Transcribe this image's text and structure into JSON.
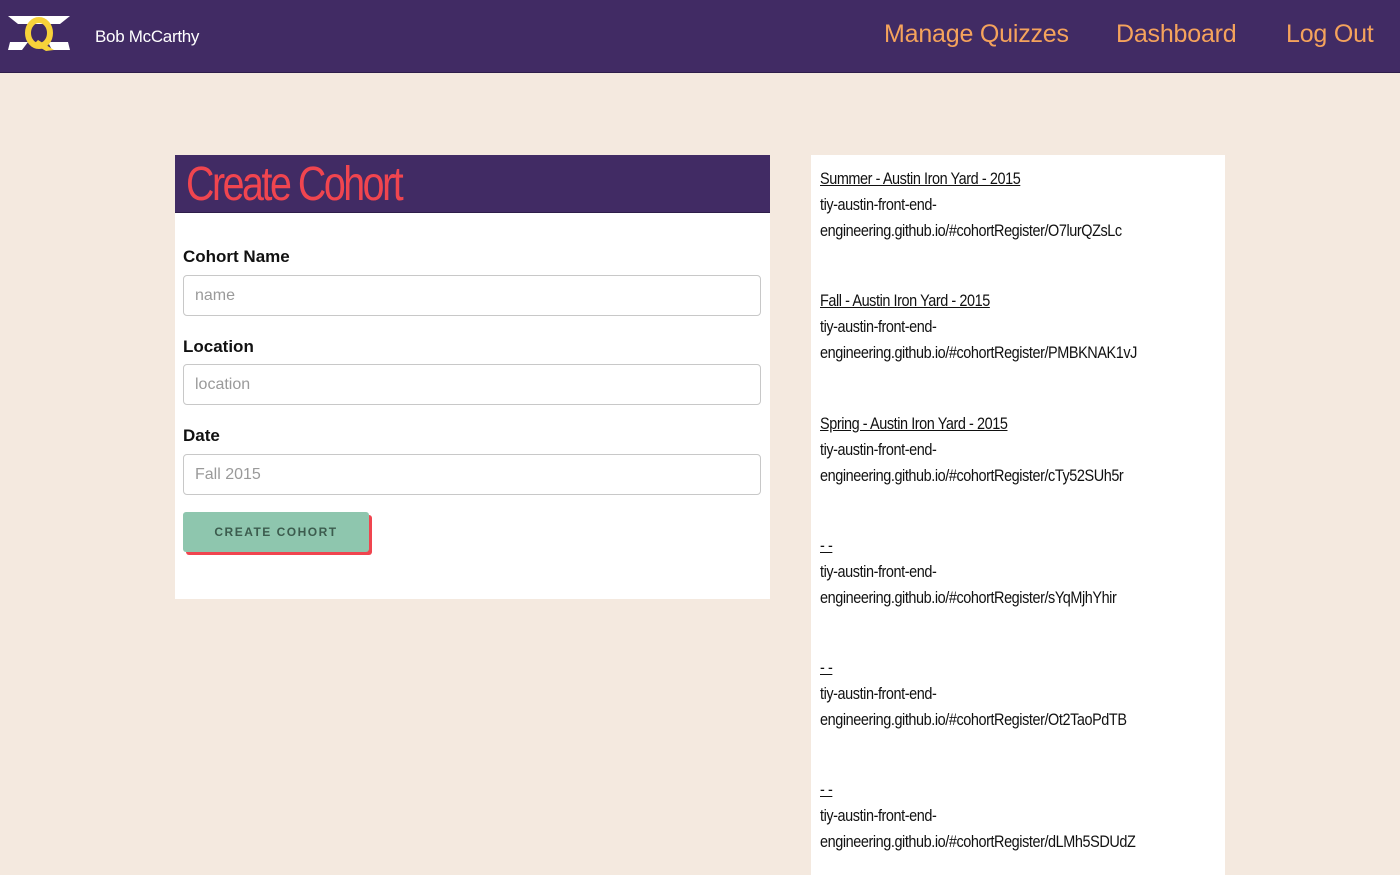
{
  "header": {
    "username": "Bob McCarthy",
    "nav": {
      "manage_quizzes": "Manage Quizzes",
      "dashboard": "Dashboard",
      "logout": "Log Out"
    }
  },
  "form": {
    "title": "Create Cohort",
    "fields": [
      {
        "label": "Cohort Name",
        "placeholder": "name",
        "value": ""
      },
      {
        "label": "Location",
        "placeholder": "location",
        "value": ""
      },
      {
        "label": "Date",
        "placeholder": "Fall 2015",
        "value": ""
      }
    ],
    "submit_label": "Create Cohort"
  },
  "cohorts": [
    {
      "title": "Summer - Austin Iron Yard - 2015",
      "url": "tiy-austin-front-end-\nengineering.github.io/#cohortRegister/O7lurQZsLc"
    },
    {
      "title": "Fall - Austin Iron Yard - 2015",
      "url": "tiy-austin-front-end-\nengineering.github.io/#cohortRegister/PMBKNAK1vJ"
    },
    {
      "title": "Spring - Austin Iron Yard - 2015",
      "url": "tiy-austin-front-end-\nengineering.github.io/#cohortRegister/cTy52SUh5r"
    },
    {
      "title": "- -",
      "url": "tiy-austin-front-end-\nengineering.github.io/#cohortRegister/sYqMjhYhir"
    },
    {
      "title": "- -",
      "url": "tiy-austin-front-end-\nengineering.github.io/#cohortRegister/Ot2TaoPdTB"
    },
    {
      "title": "- -",
      "url": "tiy-austin-front-end-\nengineering.github.io/#cohortRegister/dLMh5SDUdZ"
    }
  ],
  "colors": {
    "header_bg": "#412b64",
    "nav_link": "#f5a35c",
    "title_red": "#f0454f",
    "button_green": "#8ec6ae",
    "page_bg": "#f4e9df"
  }
}
